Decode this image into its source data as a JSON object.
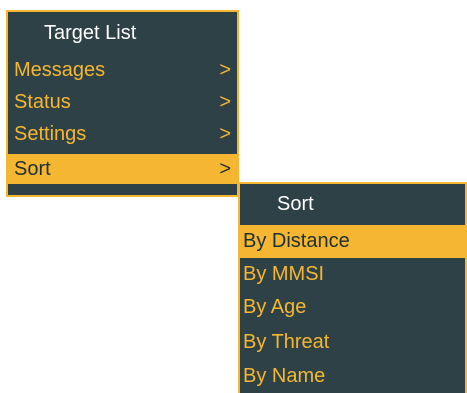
{
  "main_menu": {
    "title": "Target List",
    "items": [
      {
        "label": "Messages",
        "chevron": ">"
      },
      {
        "label": "Status",
        "chevron": ">"
      },
      {
        "label": "Settings",
        "chevron": ">"
      },
      {
        "label": "Sort",
        "chevron": ">"
      }
    ],
    "selected": "Sort"
  },
  "sort_menu": {
    "title": "Sort",
    "items": [
      {
        "label": "By Distance"
      },
      {
        "label": "By MMSI"
      },
      {
        "label": "By Age"
      },
      {
        "label": "By Threat"
      },
      {
        "label": "By Name"
      }
    ],
    "selected": "By Distance"
  },
  "colors": {
    "menu_background": "#2e4146",
    "accent": "#f5b731",
    "title_text": "#ffffff",
    "selected_text": "#1f2f33"
  }
}
